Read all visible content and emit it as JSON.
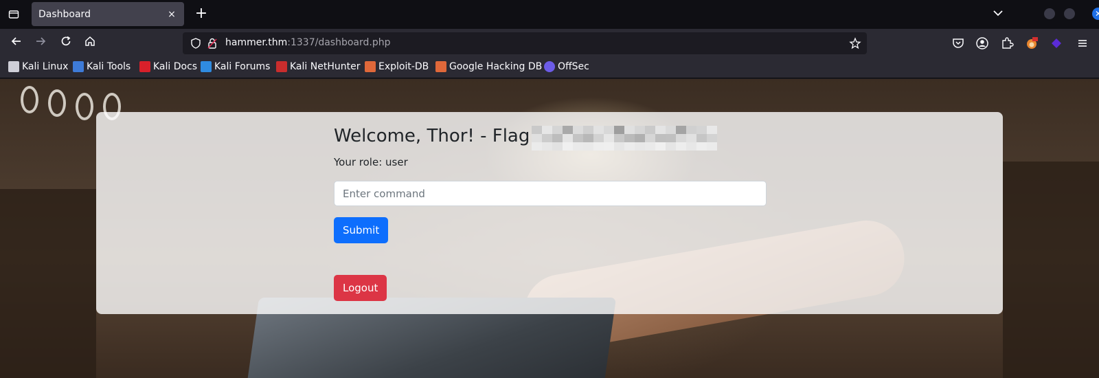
{
  "browser": {
    "tab": {
      "title": "Dashboard",
      "close": "×"
    },
    "new_tab": "+",
    "url": {
      "host": "hammer.thm",
      "path": ":1337/dashboard.php"
    },
    "bookmarks": [
      {
        "label": "Kali Linux",
        "icon": "kali-dragon-icon",
        "color": "#cfcfd8"
      },
      {
        "label": "Kali Tools",
        "icon": "kali-tools-icon",
        "color": "#3e7bd8"
      },
      {
        "label": "Kali Docs",
        "icon": "kali-docs-icon",
        "color": "#d8202a"
      },
      {
        "label": "Kali Forums",
        "icon": "kali-forums-icon",
        "color": "#2f8be0"
      },
      {
        "label": "Kali NetHunter",
        "icon": "nethunter-icon",
        "color": "#c92d2d"
      },
      {
        "label": "Exploit-DB",
        "icon": "exploitdb-icon",
        "color": "#e0683a"
      },
      {
        "label": "Google Hacking DB",
        "icon": "ghdb-icon",
        "color": "#e0683a"
      },
      {
        "label": "OffSec",
        "icon": "offsec-icon",
        "color": "#6c5ce7"
      }
    ]
  },
  "page": {
    "welcome": "Welcome, Thor! - Flag:",
    "role": "Your role: user",
    "command_placeholder": "Enter command",
    "submit_label": "Submit",
    "logout_label": "Logout"
  },
  "colors": {
    "submit": "#0d6efd",
    "logout": "#dc3545",
    "card": "rgba(255,255,255,0.8)"
  }
}
